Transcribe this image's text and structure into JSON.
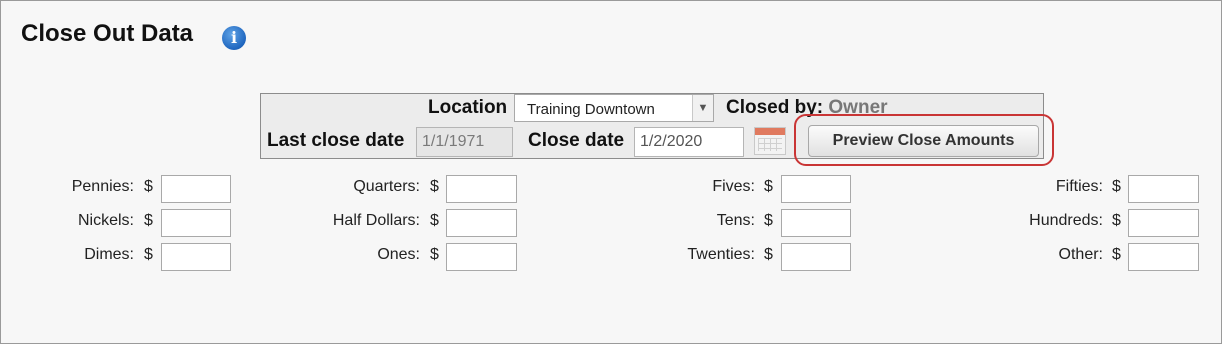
{
  "header": {
    "title": "Close Out Data",
    "info_icon": "info-icon"
  },
  "panel": {
    "location_label": "Location",
    "location_value": "Training Downtown",
    "closed_by_label": "Closed by:",
    "closed_by_value": "Owner",
    "last_close_label": "Last close date",
    "last_close_value": "1/1/1971",
    "close_date_label": "Close date",
    "close_date_value": "1/2/2020",
    "preview_label": "Preview Close Amounts",
    "highlight_color": "#c93535"
  },
  "currency_symbol": "$",
  "denominations": {
    "pennies": "Pennies:",
    "nickels": "Nickels:",
    "dimes": "Dimes:",
    "quarters": "Quarters:",
    "half_dollars": "Half Dollars:",
    "ones": "Ones:",
    "fives": "Fives:",
    "tens": "Tens:",
    "twenties": "Twenties:",
    "fifties": "Fifties:",
    "hundreds": "Hundreds:",
    "other": "Other:"
  }
}
